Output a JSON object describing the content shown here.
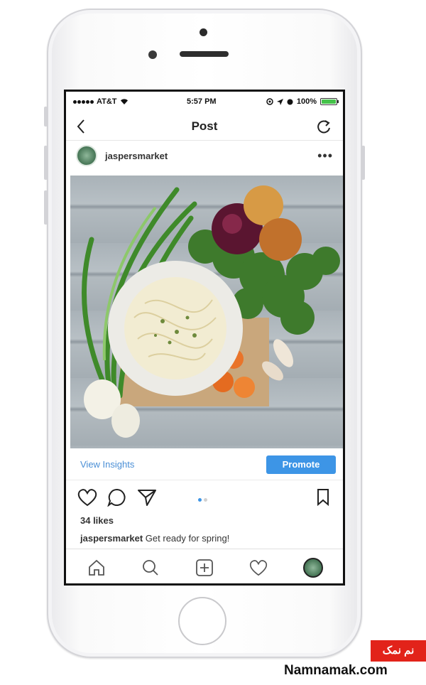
{
  "status_bar": {
    "carrier": "AT&T",
    "time": "5:57 PM",
    "battery": "100%"
  },
  "nav": {
    "title": "Post"
  },
  "post": {
    "username": "jaspersmarket",
    "insights_label": "View Insights",
    "promote_label": "Promote",
    "likes": "34 likes",
    "caption_user": "jaspersmarket",
    "caption_text": "Get ready for spring!",
    "carousel": {
      "count": 2,
      "active_index": 0
    }
  },
  "colors": {
    "accent": "#3d95e6",
    "link": "#4a8fd6",
    "battery": "#45c24a",
    "watermark_red": "#e2231a"
  },
  "icons": {
    "nav": [
      "chevron-left-icon",
      "refresh-icon",
      "more-icon"
    ],
    "actions": [
      "heart-icon",
      "comment-icon",
      "send-icon",
      "bookmark-icon"
    ],
    "tabs": [
      "home-icon",
      "search-icon",
      "add-icon",
      "activity-heart-icon",
      "profile-avatar"
    ]
  },
  "watermark": {
    "badge": "نم نمک",
    "site": "Namnamak.com"
  }
}
